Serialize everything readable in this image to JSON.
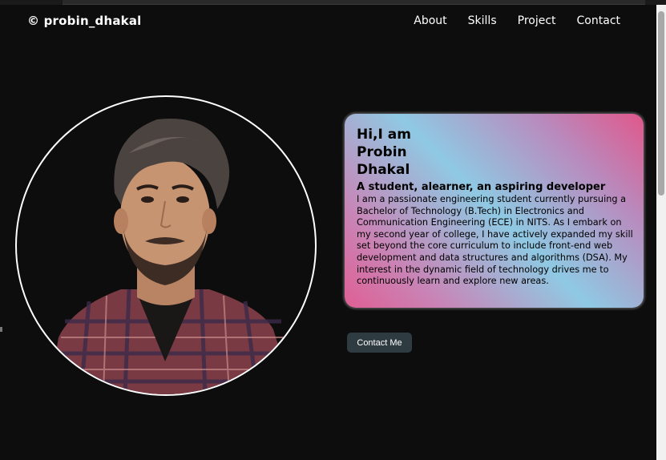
{
  "header": {
    "logo": "© probin_dhakal",
    "nav": [
      {
        "label": "About"
      },
      {
        "label": "Skills"
      },
      {
        "label": "Project"
      },
      {
        "label": "Contact"
      }
    ]
  },
  "hero": {
    "greeting_line1": "Hi,I am",
    "name_first": "Probin",
    "name_last": "Dhakal",
    "tagline": "A student, alearner, an aspiring developer",
    "bio": "I am a passionate engineering student currently pursuing a Bachelor of Technology (B.Tech) in Electronics and Communication Engineering (ECE) in NITS. As I embark on my second year of college, I have actively expanded my skill set beyond the core curriculum to include front-end web development and data structures and algorithms (DSA). My interest in the dynamic field of technology drives me to continuously learn and explore new areas.",
    "cta_label": "Contact Me"
  },
  "colors": {
    "page_bg": "#0d0d0d",
    "card_gradient": [
      "#df5f94",
      "#8fc9e3",
      "#e1578b"
    ],
    "button_bg": "#2e3b40"
  },
  "icons": {
    "copyright": "copyright-icon",
    "portrait": "profile-photo"
  }
}
